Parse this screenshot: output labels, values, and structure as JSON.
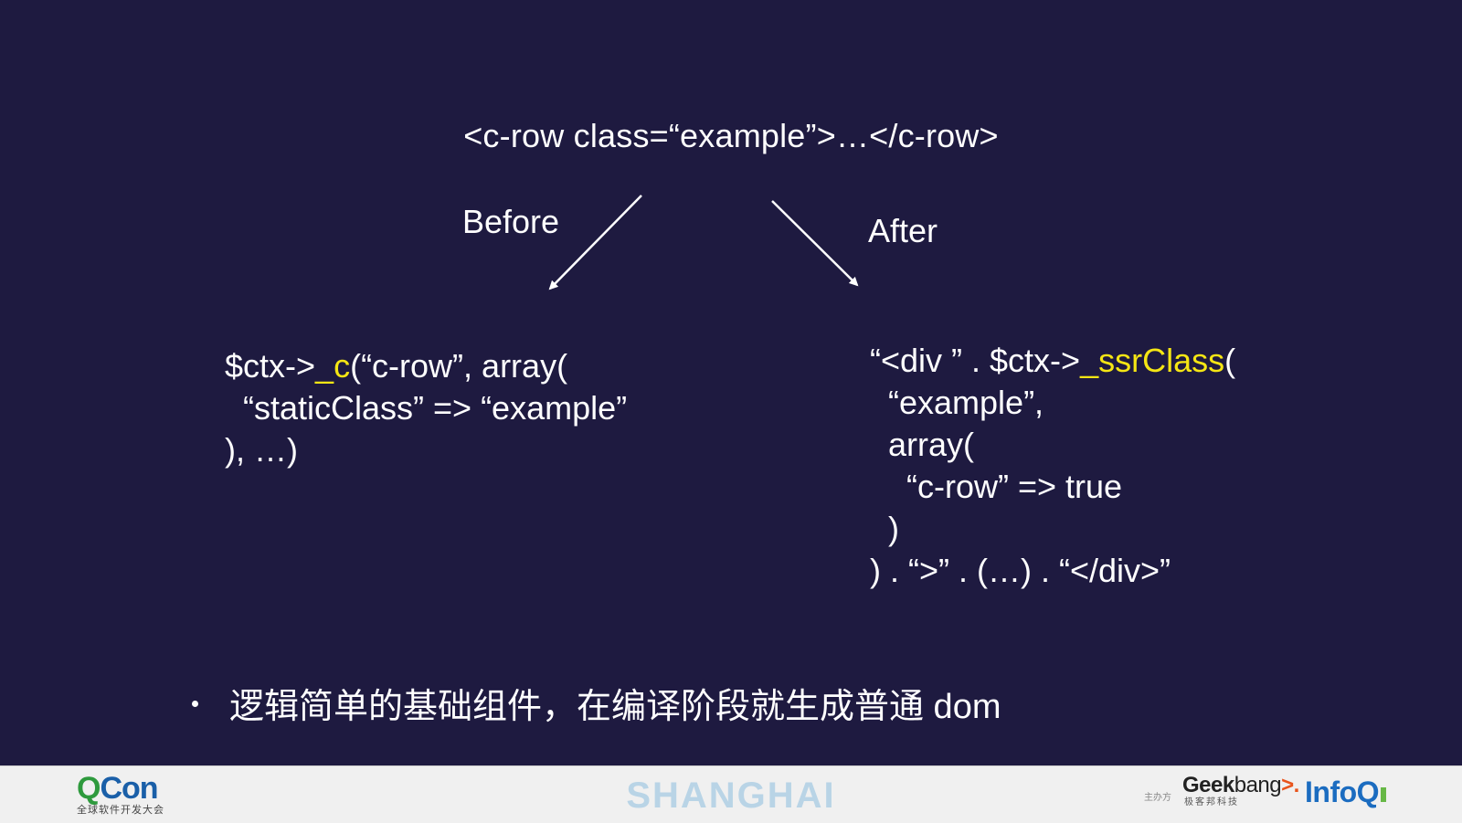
{
  "slide": {
    "title": "<c-row class=“example”>…</c-row>",
    "before_label": "Before",
    "after_label": "After",
    "before_code": {
      "line1_pre": "$ctx->",
      "line1_hl": "_c",
      "line1_post": "(“c-row”, array(",
      "line2": "  “staticClass” => “example”",
      "line3": "), …)"
    },
    "after_code": {
      "line1_pre": "“<div ” . $ctx->",
      "line1_hl": "_ssrClass",
      "line1_post": "(",
      "line2": "  “example”,",
      "line3": "  array(",
      "line4": "    “c-row” => true",
      "line5": "  )",
      "line6": ") . “>” . (…) . “</div>”"
    },
    "bullet": "逻辑简单的基础组件，在编译阶段就生成普通 dom",
    "highlight_color": "#f5e614",
    "background_color": "#1e1a40"
  },
  "footer": {
    "qcon_q": "Q",
    "qcon_rest": "Con",
    "qcon_sub": "全球软件开发大会",
    "city": "SHANGHAI",
    "sponsor_label": "主办方",
    "geek_part1": "Geek",
    "geek_part2": "bang",
    "geek_arrow": ">.",
    "geek_sub": "极客邦科技",
    "infoq": "InfoQ"
  }
}
